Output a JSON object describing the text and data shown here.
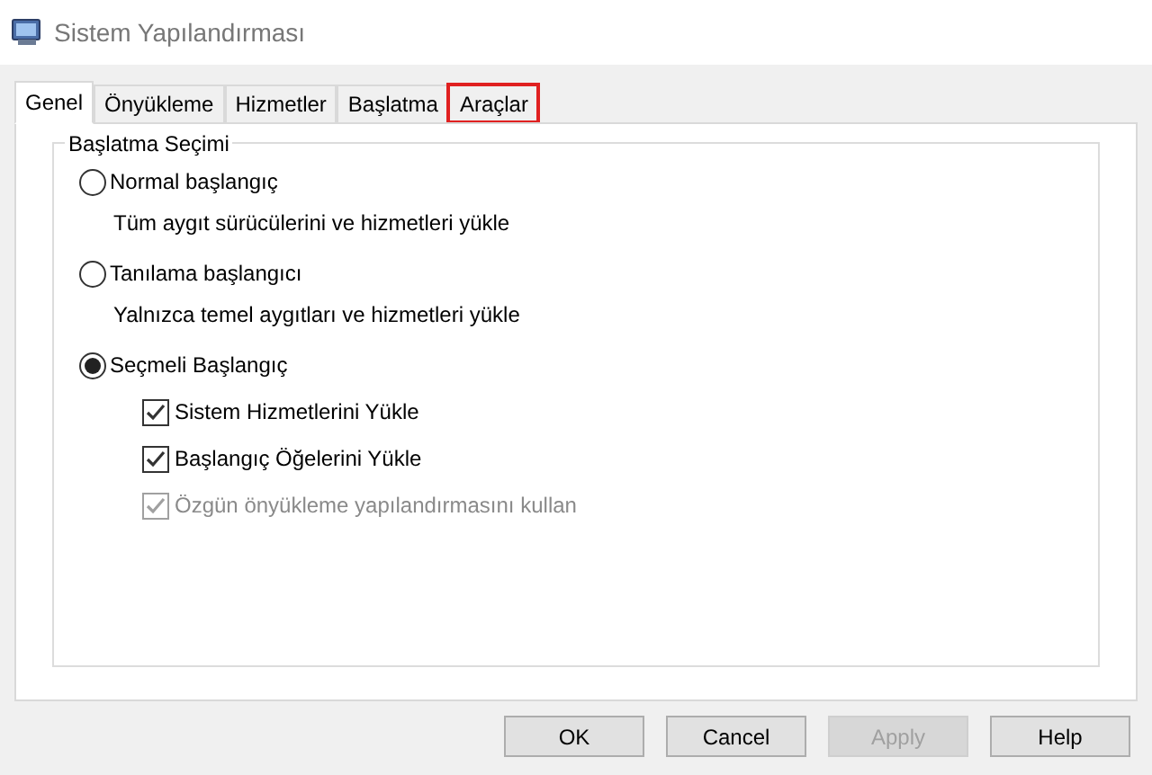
{
  "window": {
    "title": "Sistem Yapılandırması"
  },
  "tabs": [
    {
      "label": "Genel",
      "selected": true,
      "highlighted": false
    },
    {
      "label": "Önyükleme",
      "selected": false,
      "highlighted": false
    },
    {
      "label": "Hizmetler",
      "selected": false,
      "highlighted": false
    },
    {
      "label": "Başlatma",
      "selected": false,
      "highlighted": false
    },
    {
      "label": "Araçlar",
      "selected": false,
      "highlighted": true
    }
  ],
  "group": {
    "title": "Başlatma Seçimi"
  },
  "options": [
    {
      "kind": "radio",
      "label": "Normal başlangıç",
      "selected": false,
      "description": "Tüm aygıt sürücülerini ve hizmetleri yükle"
    },
    {
      "kind": "radio",
      "label": "Tanılama başlangıcı",
      "selected": false,
      "description": "Yalnızca temel aygıtları ve hizmetleri yükle"
    },
    {
      "kind": "radio",
      "label": "Seçmeli Başlangıç",
      "selected": true
    },
    {
      "kind": "checkbox",
      "label": "Sistem Hizmetlerini Yükle",
      "checked": true,
      "disabled": false
    },
    {
      "kind": "checkbox",
      "label": "Başlangıç Öğelerini Yükle",
      "checked": true,
      "disabled": false
    },
    {
      "kind": "checkbox",
      "label": "Özgün önyükleme yapılandırmasını kullan",
      "checked": true,
      "disabled": true
    }
  ],
  "buttons": [
    {
      "label": "OK",
      "disabled": false
    },
    {
      "label": "Cancel",
      "disabled": false
    },
    {
      "label": "Apply",
      "disabled": true
    },
    {
      "label": "Help",
      "disabled": false
    }
  ]
}
